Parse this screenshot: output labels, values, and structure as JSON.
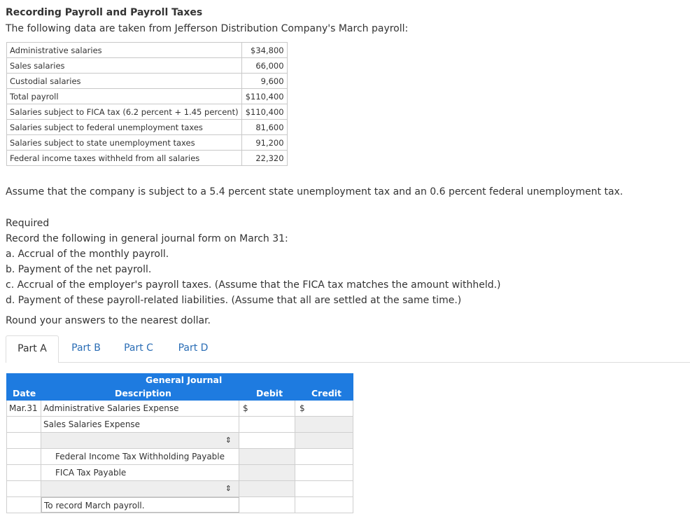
{
  "header": {
    "title": "Recording Payroll and Payroll Taxes",
    "intro": "The following data are taken from Jefferson Distribution Company's March payroll:"
  },
  "payroll_table": [
    {
      "label": "Administrative salaries",
      "amount": "$34,800"
    },
    {
      "label": "Sales salaries",
      "amount": "66,000"
    },
    {
      "label": "Custodial salaries",
      "amount": "9,600"
    },
    {
      "label": "Total payroll",
      "amount": "$110,400"
    },
    {
      "label": "Salaries subject to FICA tax (6.2 percent + 1.45 percent)",
      "amount": "$110,400"
    },
    {
      "label": "Salaries subject to federal unemployment taxes",
      "amount": "81,600"
    },
    {
      "label": "Salaries subject to state unemployment taxes",
      "amount": "91,200"
    },
    {
      "label": "Federal income taxes withheld from all salaries",
      "amount": "22,320"
    }
  ],
  "assumption": "Assume that the company is subject to a 5.4 percent state unemployment tax and an 0.6 percent federal unemployment tax.",
  "required": {
    "heading": "Required",
    "instruction": "Record the following in general journal form on March 31:",
    "items": [
      "a. Accrual of the monthly payroll.",
      "b. Payment of the net payroll.",
      "c. Accrual of the employer's payroll taxes. (Assume that the FICA tax matches the amount withheld.)",
      "d. Payment of these payroll-related liabilities. (Assume that all are settled at the same time.)"
    ],
    "rounding": "Round your answers to the nearest dollar."
  },
  "tabs": [
    "Part A",
    "Part B",
    "Part C",
    "Part D"
  ],
  "journal": {
    "title": "General Journal",
    "col_date": "Date",
    "col_desc": "Description",
    "col_debit": "Debit",
    "col_credit": "Credit",
    "dollar": "$",
    "select_arrow": "⇕",
    "rows": [
      {
        "date": "Mar.31",
        "desc": "Administrative Salaries Expense"
      },
      {
        "date": "",
        "desc": "Sales Salaries Expense"
      },
      {
        "date": "",
        "desc": ""
      },
      {
        "date": "",
        "desc": "Federal Income Tax Withholding Payable"
      },
      {
        "date": "",
        "desc": "FICA Tax Payable"
      },
      {
        "date": "",
        "desc": ""
      },
      {
        "date": "",
        "desc": "To record March payroll."
      }
    ]
  }
}
